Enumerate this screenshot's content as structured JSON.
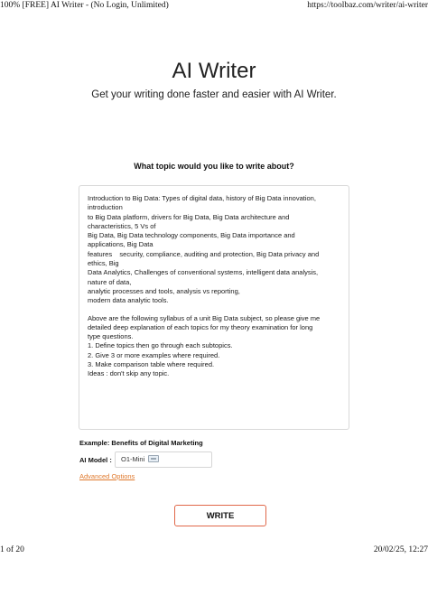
{
  "print_header": {
    "left": "100% [FREE] AI Writer - (No Login, Unlimited)",
    "right": "https://toolbaz.com/writer/ai-writer"
  },
  "print_footer": {
    "left": "1 of 20",
    "right": "20/02/25, 12:27"
  },
  "main": {
    "title": "AI Writer",
    "subtitle": "Get your writing done faster and easier with AI Writer.",
    "topic_question": "What topic would you like to write about?",
    "topic_lines": [
      "Introduction to Big Data: Types of digital data, history of Big Data innovation,",
      "introduction",
      "to Big Data platform, drivers for Big Data, Big Data architecture and",
      "characteristics, 5 Vs of",
      "Big Data, Big Data technology components, Big Data importance and",
      "applications, Big Data",
      "features    security, compliance, auditing and protection, Big Data privacy and",
      "ethics, Big",
      "Data Analytics, Challenges of conventional systems, intelligent data analysis,",
      "nature of data,",
      "analytic processes and tools, analysis vs reporting,",
      "modern data analytic tools."
    ],
    "instruction_lines": [
      "Above are the following syllabus of a unit Big Data subject, so please give me",
      "detailed deep explanation of each topics for my theory examination for long",
      "type questions.",
      "1. Define topics then go through each subtopics.",
      "2. Give 3 or more examples where required.",
      "3. Make comparison table where required.",
      "Ideas : don't skip any topic."
    ],
    "example": "Example: Benefits of Digital Marketing",
    "model_label": "AI Model :",
    "model_value": "O1-Mini",
    "model_icon": "new-badge-icon",
    "advanced_link": "Advanced Options",
    "write_label": "WRITE"
  },
  "colors": {
    "accent_link": "#e07a2e",
    "button_border": "#e0684a"
  }
}
